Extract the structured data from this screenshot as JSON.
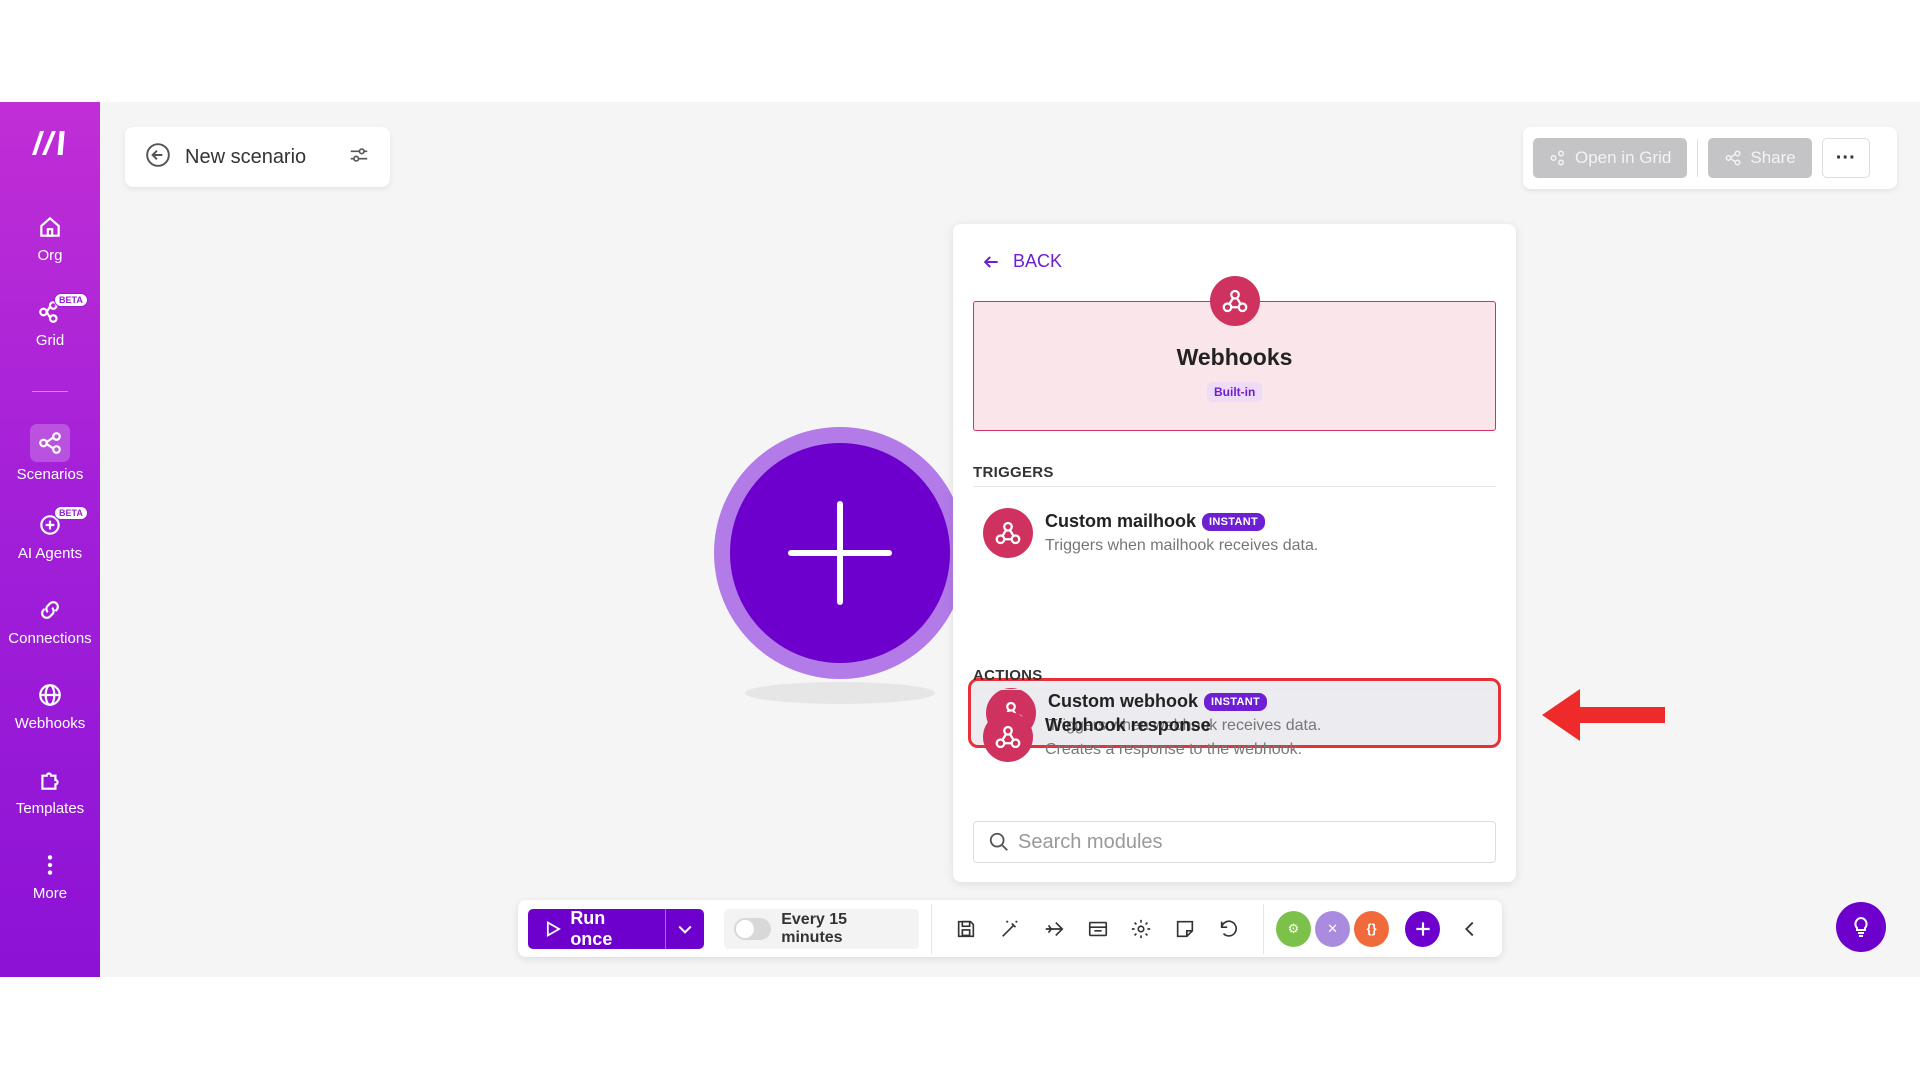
{
  "sidebar": {
    "items": [
      {
        "label": "Org",
        "icon": "home-icon"
      },
      {
        "label": "Grid",
        "icon": "grid-icon",
        "badge": "BETA"
      },
      {
        "label": "Scenarios",
        "icon": "share-icon"
      },
      {
        "label": "AI Agents",
        "icon": "ai-agent-icon",
        "badge": "BETA"
      },
      {
        "label": "Connections",
        "icon": "link-icon"
      },
      {
        "label": "Webhooks",
        "icon": "globe-icon"
      },
      {
        "label": "Templates",
        "icon": "puzzle-icon"
      },
      {
        "label": "More",
        "icon": "dots-vertical-icon"
      }
    ]
  },
  "header": {
    "scenario_name": "New scenario",
    "open_in_grid": "Open in Grid",
    "share": "Share",
    "more": "···"
  },
  "panel": {
    "back": "BACK",
    "app_name": "Webhooks",
    "app_badge": "Built-in",
    "triggers_heading": "TRIGGERS",
    "actions_heading": "ACTIONS",
    "triggers": [
      {
        "title": "Custom mailhook",
        "badge": "INSTANT",
        "description": "Triggers when mailhook receives data."
      },
      {
        "title": "Custom webhook",
        "badge": "INSTANT",
        "description": "Triggers when webhook receives data."
      }
    ],
    "actions": [
      {
        "title": "Webhook response",
        "description": "Creates a response to the webhook."
      }
    ],
    "search_placeholder": "Search modules"
  },
  "toolbar": {
    "run_once": "Run once",
    "schedule": "Every 15 minutes",
    "avatars": [
      {
        "color": "#7cc24a",
        "label": "⚙"
      },
      {
        "color": "#a98ce0",
        "label": "✕"
      },
      {
        "color": "#f06a3c",
        "label": "{}"
      }
    ]
  },
  "colors": {
    "brand": "#6d00cc",
    "sidebar_top": "#c02ed6",
    "webhook_red": "#d0325f",
    "highlight": "#e8303a"
  }
}
